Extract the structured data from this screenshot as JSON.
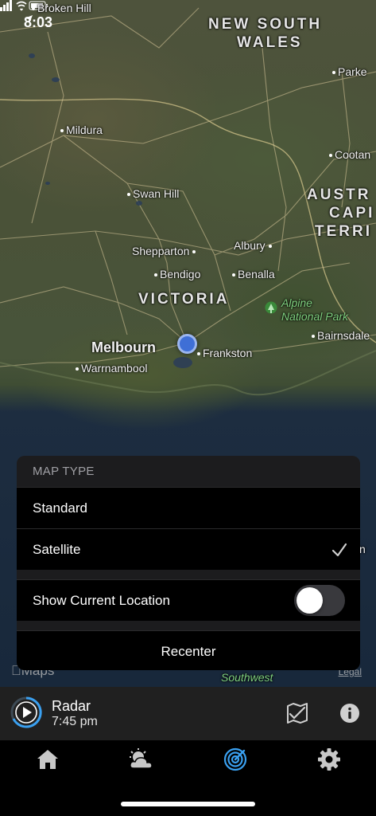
{
  "status_bar": {
    "time": "8:03"
  },
  "map": {
    "places": {
      "broken_hill": "Broken Hill",
      "nsw_line1": "NEW SOUTH",
      "nsw_line2": "WALES",
      "parkes": "Parke",
      "mildura": "Mildura",
      "cootamundra": "Cootan",
      "swan_hill": "Swan Hill",
      "act_line1": "AUSTR",
      "act_line2": "CAPI",
      "act_line3": "TERRI",
      "shepparton": "Shepparton",
      "albury": "Albury",
      "bendigo": "Bendigo",
      "benalla": "Benalla",
      "victoria": "VICTORIA",
      "alpine_line1": "Alpine",
      "alpine_line2": "National Park",
      "bairnsdale": "Bairnsdale",
      "melbourne": "Melbourn",
      "frankston": "Frankston",
      "warrnambool": "Warrnambool",
      "southwest": "Southwest",
      "edge_n": "n"
    },
    "attribution": "Maps",
    "legal": "Legal"
  },
  "map_type_sheet": {
    "header": "MAP TYPE",
    "options": [
      "Standard",
      "Satellite"
    ],
    "selected": "Satellite",
    "show_location_label": "Show Current Location",
    "show_location_on": false,
    "recenter_label": "Recenter"
  },
  "radar_bar": {
    "title": "Radar",
    "time": "7:45 pm"
  },
  "tab_bar": {
    "tabs": [
      "home",
      "forecast",
      "radar",
      "settings"
    ],
    "active": "radar",
    "accent_color": "#3aa0f0"
  },
  "icons": [
    "location-arrow-icon",
    "signal-icon",
    "wifi-icon",
    "battery-icon",
    "checkmark-icon",
    "play-icon",
    "map-style-icon",
    "info-icon",
    "home-icon",
    "cloud-sun-icon",
    "radar-icon",
    "gear-icon",
    "alpine-park-icon"
  ]
}
